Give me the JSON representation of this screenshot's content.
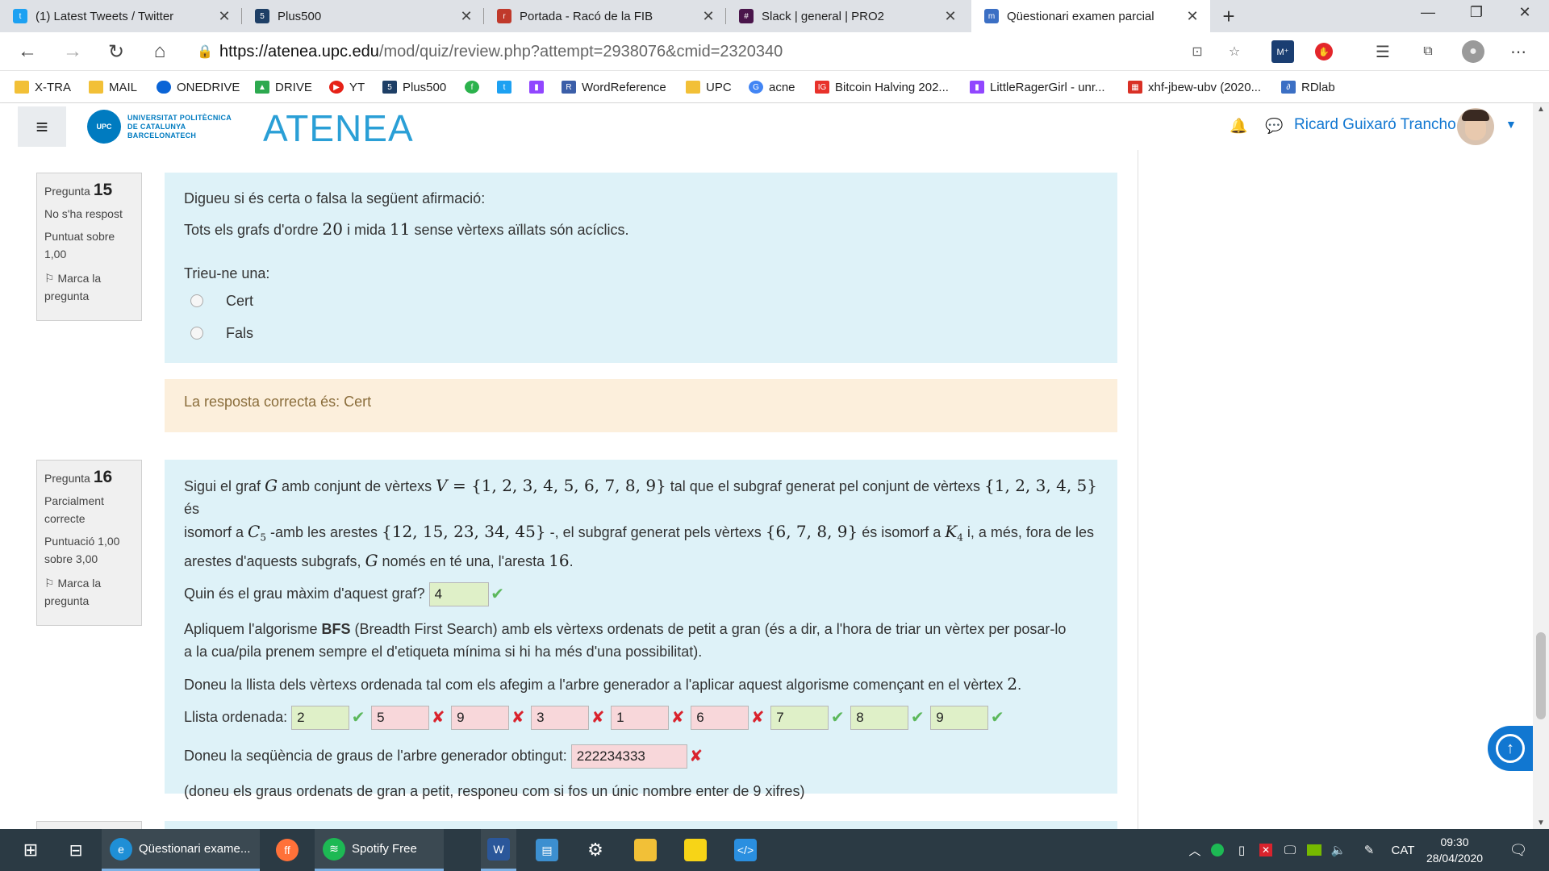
{
  "browser": {
    "tabs": [
      {
        "label": "(1) Latest Tweets / Twitter",
        "icon": "twitter-icon",
        "color": "#1da1f2",
        "active": false
      },
      {
        "label": "Plus500",
        "icon": "plus500-icon",
        "color": "#1e3f66",
        "active": false
      },
      {
        "label": "Portada - Racó de la FIB",
        "icon": "raco-icon",
        "color": "#c0392b",
        "active": false
      },
      {
        "label": "Slack | general | PRO2",
        "icon": "slack-icon",
        "color": "#4a154b",
        "active": false
      },
      {
        "label": "Qüestionari examen parcial",
        "icon": "moodle-icon",
        "color": "#3b6fc4",
        "active": true
      }
    ],
    "new_tab": "+",
    "url_host": "https://atenea.upc.edu",
    "url_path": "/mod/quiz/review.php?attempt=2938076&cmid=2320340",
    "bookmarks": [
      {
        "label": "X-TRA",
        "icon": "folder-icon",
        "color": "#f2c037"
      },
      {
        "label": "MAIL",
        "icon": "folder-icon",
        "color": "#f2c037"
      },
      {
        "label": "ONEDRIVE",
        "icon": "onedrive-icon",
        "color": "#0a64d6"
      },
      {
        "label": "DRIVE",
        "icon": "drive-icon",
        "color": "#2da94f"
      },
      {
        "label": "YT",
        "icon": "youtube-icon",
        "color": "#e62117"
      },
      {
        "label": "Plus500",
        "icon": "plus500-icon",
        "color": "#1e3f66"
      },
      {
        "label": "",
        "icon": "feedly-icon",
        "color": "#2bb24c"
      },
      {
        "label": "",
        "icon": "twitter-icon",
        "color": "#1da1f2"
      },
      {
        "label": "",
        "icon": "twitch-icon",
        "color": "#9146ff"
      },
      {
        "label": "WordReference",
        "icon": "wordreference-icon",
        "color": "#3b5ea8"
      },
      {
        "label": "UPC",
        "icon": "folder-icon",
        "color": "#f2c037"
      },
      {
        "label": "acne",
        "icon": "google-icon",
        "color": "#4285f4"
      },
      {
        "label": "Bitcoin Halving 202...",
        "icon": "ig-icon",
        "color": "#e8322b"
      },
      {
        "label": "LittleRagerGirl - unr...",
        "icon": "twitch-icon",
        "color": "#9146ff"
      },
      {
        "label": "xhf-jbew-ubv (2020...",
        "icon": "calendar-icon",
        "color": "#d93025"
      },
      {
        "label": "RDlab",
        "icon": "rdlab-icon",
        "color": "#3b6fc4"
      }
    ]
  },
  "moodle": {
    "upc_logo_lines": [
      "UNIVERSITAT POLITÈCNICA",
      "DE CATALUNYA",
      "BARCELONATECH"
    ],
    "upc_mark": "UPC",
    "site_logo": "ATENEA",
    "user_name": "Ricard Guixaró Trancho"
  },
  "q15": {
    "label": "Pregunta",
    "number": "15",
    "state": "No s'ha respost",
    "mark_line1": "Puntuat sobre",
    "mark_line2": "1,00",
    "flag_line1": "Marca la",
    "flag_line2": "pregunta",
    "prompt": "Digueu si és certa o falsa la següent afirmació:",
    "statement_a": "Tots els grafs d'ordre ",
    "statement_order": "20",
    "statement_b": " i mida ",
    "statement_size": "11",
    "statement_c": " sense vèrtexs aïllats són acíclics.",
    "choose": "Trieu-ne una:",
    "options": [
      "Cert",
      "Fals"
    ],
    "correct_answer": "La resposta correcta és: Cert"
  },
  "q16": {
    "label": "Pregunta",
    "number": "16",
    "state_line1": "Parcialment",
    "state_line2": "correcte",
    "mark_line1": "Puntuació 1,00",
    "mark_line2": "sobre 3,00",
    "flag_line1": "Marca la",
    "flag_line2": "pregunta",
    "t1": "Sigui el graf ",
    "G": "G",
    "t2": " amb conjunt de vèrtexs ",
    "V": "V",
    "set_v": " = {1, 2, 3, 4, 5, 6, 7, 8, 9}",
    "t3": " tal que el subgraf generat pel conjunt de vèrtexs ",
    "set_a": "{1, 2, 3, 4, 5}",
    "t4": " és",
    "t5": "isomorf a ",
    "C": "C",
    "C_sub": "5",
    "t6": " -amb les arestes ",
    "set_e": "{12, 15, 23, 34, 45}",
    "t7": " -, el subgraf generat pels vèrtexs ",
    "set_b": "{6, 7, 8, 9}",
    "t8": " és isomorf a ",
    "K": "K",
    "K_sub": "4",
    "t9": " i, a més, fora de les",
    "t10": "arestes d'aquests subgrafs, ",
    "t11": " només en té una, l'aresta ",
    "edge": "16",
    "t12": ".",
    "max_degree_q": "Quin és el grau màxim d'aquest graf?",
    "max_degree_a": "4",
    "bfs_a": "Apliquem l'algorisme ",
    "bfs_b": "BFS",
    "bfs_c": " (Breadth First Search) amb els vèrtexs ordenats de petit a gran (és a dir, a l'hora de triar un vèrtex per posar-lo",
    "bfs_d": "a la cua/pila prenem sempre el d'etiqueta mínima si hi ha més d'una possibilitat).",
    "list_q_a": "Doneu la llista dels vèrtexs ordenada tal com els afegim a l'arbre generador a l'aplicar aquest algorisme començant en el vèrtex ",
    "list_q_v": "2",
    "list_q_b": ".",
    "list_label": "Llista ordenada:",
    "list_answers": [
      {
        "value": "2",
        "correct": true
      },
      {
        "value": "5",
        "correct": false
      },
      {
        "value": "9",
        "correct": false
      },
      {
        "value": "3",
        "correct": false
      },
      {
        "value": "1",
        "correct": false
      },
      {
        "value": "6",
        "correct": false
      },
      {
        "value": "7",
        "correct": true
      },
      {
        "value": "8",
        "correct": true
      },
      {
        "value": "9",
        "correct": true
      }
    ],
    "seq_q": "Doneu la seqüència de graus de l'arbre generador obtingut:",
    "seq_a": "222234333",
    "seq_note": "(doneu els graus ordenats de gran a petit, responeu com si fos un únic nombre enter de 9 xifres)"
  },
  "marks": {
    "tick": "✔",
    "cross": "✘"
  },
  "taskbar": {
    "apps": [
      {
        "label": "Qüestionari exame...",
        "icon": "edge-icon",
        "color": "#1f8fd6"
      },
      {
        "label": "",
        "icon": "firefox-icon",
        "color": "#ff7139"
      },
      {
        "label": "Spotify Free",
        "icon": "spotify-icon",
        "color": "#1db954"
      },
      {
        "label": "",
        "icon": "word-icon",
        "color": "#2b579a"
      },
      {
        "label": "",
        "icon": "news-icon",
        "color": "#3c8fd0"
      },
      {
        "label": "",
        "icon": "settings-icon",
        "color": "#2b3a44"
      },
      {
        "label": "",
        "icon": "explorer-icon",
        "color": "#f2c037"
      },
      {
        "label": "",
        "icon": "sticky-notes-icon",
        "color": "#f7d417"
      },
      {
        "label": "",
        "icon": "vscode-icon",
        "color": "#2a8fe0"
      }
    ],
    "lang": "CAT",
    "time": "09:30",
    "date": "28/04/2020"
  }
}
